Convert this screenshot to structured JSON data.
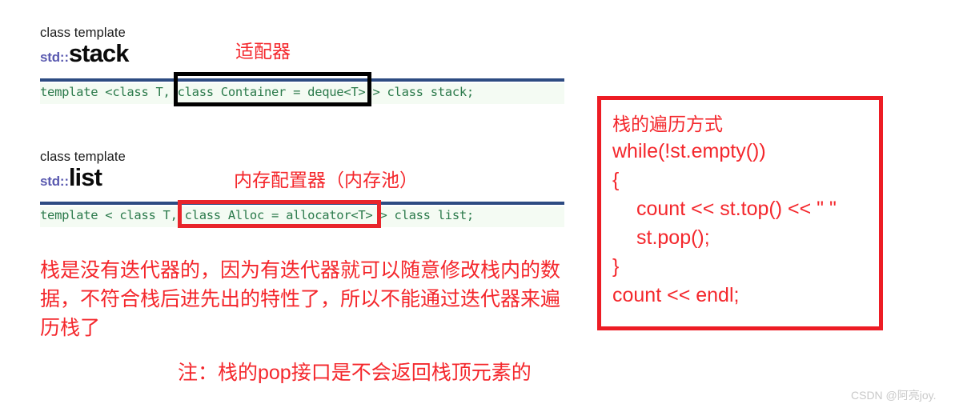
{
  "blocks": [
    {
      "kind_label": "class template",
      "namespace": "std::",
      "name": "stack",
      "annotation": "适配器",
      "signature": "template <class T, class Container = deque<T> > class stack;",
      "highlight_text": "class Container = deque<T>",
      "highlight_color": "#000000"
    },
    {
      "kind_label": "class template",
      "namespace": "std::",
      "name": "list",
      "annotation": "内存配置器（内存池）",
      "signature": "template < class T, class Alloc = allocator<T> > class list;",
      "highlight_text": "class Alloc = allocator<T>",
      "highlight_color": "#e8252b"
    }
  ],
  "paragraph": {
    "lines": [
      "栈是没有迭代器的，因为有迭代器就可以随意修改栈内的数",
      "据，不符合栈后进先出的特性了，所以不能通过迭代器来遍",
      "历栈了"
    ]
  },
  "note": "注：栈的pop接口是不会返回栈顶元素的",
  "code_panel": {
    "lines": [
      "栈的遍历方式",
      "while(!st.empty())",
      "{",
      "count << st.top() << \" \"",
      "st.pop();",
      "}",
      "count << endl;"
    ]
  },
  "watermark": "CSDN @阿亮joy.",
  "colors": {
    "annotation_red": "#f4272c",
    "panel_border_red": "#ed1c24",
    "code_green": "#2b7a4b",
    "rule_navy": "#2d4b82",
    "namespace_blue": "#5a5ab0"
  }
}
